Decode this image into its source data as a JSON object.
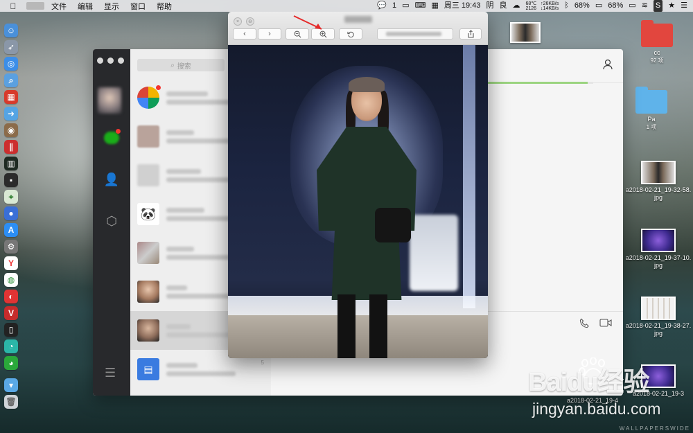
{
  "menubar": {
    "items": [
      "文件",
      "编辑",
      "显示",
      "窗口",
      "帮助"
    ],
    "right": {
      "cpu_temp": "68℃",
      "cpu_rpm": "2126",
      "net_up": "↑26KB/s",
      "net_down": "↓14KB/s",
      "wechat_badge": "1",
      "datetime": "周三 19:43",
      "weather": "阴",
      "air": "良",
      "battery_1": "68%",
      "battery_2": "68%"
    }
  },
  "chat": {
    "search_placeholder": "搜索",
    "conversation_time": "5"
  },
  "preview": {
    "progress_fraction": 0.95
  },
  "desktop_files": [
    {
      "name": "cc",
      "sub": "92 项",
      "color": "#e2463e"
    },
    {
      "name": "Pa",
      "sub": "1 项",
      "color": "#5fb3ea"
    },
    {
      "name": "a2018-02-21_19-32-58.jpg"
    },
    {
      "name": "a2018-02-21_19-37-10.jpg"
    },
    {
      "name": "a2018-02-21_19-38-27.jpg"
    },
    {
      "name": "a2018-02-21_19-4"
    },
    {
      "name": "a2018-02-21_19-3"
    }
  ],
  "watermark": {
    "logo": "Baidu经验",
    "site": "jingyan.baidu.com",
    "credit": "WALLPAPERSWIDE"
  },
  "icons": {
    "apple": "apple-icon",
    "wifi": "wifi-icon",
    "bluetooth": "bluetooth-icon",
    "zoom_in": "zoom-in-icon",
    "zoom_out": "zoom-out-icon",
    "rotate": "rotate-icon",
    "share": "share-icon"
  }
}
